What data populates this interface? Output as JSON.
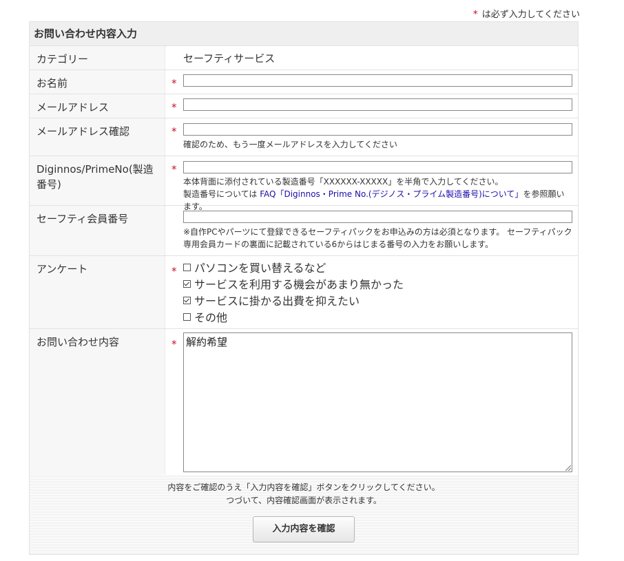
{
  "required_note": {
    "marker": "*",
    "text": "は必ず入力してください"
  },
  "form": {
    "title": "お問い合わせ内容入力",
    "category": {
      "label": "カテゴリー",
      "value": "セーフティサービス"
    },
    "name": {
      "label": "お名前",
      "value": ""
    },
    "email": {
      "label": "メールアドレス",
      "value": ""
    },
    "email_confirm": {
      "label": "メールアドレス確認",
      "value": "",
      "help": "確認のため、もう一度メールアドレスを入力してください"
    },
    "serial": {
      "label": "Diginnos/PrimeNo(製造番号)",
      "value": "",
      "help1": "本体背面に添付されている製造番号「XXXXXX-XXXXX」を半角で入力してください。",
      "help2_prefix": "製造番号については",
      "help2_link": "FAQ「Diginnos・Prime No.(デジノス・プライム製造番号)について」",
      "help2_suffix": "を参照願います。"
    },
    "member": {
      "label": "セーフティ会員番号",
      "value": "",
      "help": "※自作PCやパーツにて登録できるセーフティパックをお申込みの方は必須となります。 セーフティパック専用会員カードの裏面に記載されている6からはじまる番号の入力をお願いします。"
    },
    "survey": {
      "label": "アンケート",
      "options": [
        {
          "label": "パソコンを買い替えるなど",
          "checked": false
        },
        {
          "label": "サービスを利用する機会があまり無かった",
          "checked": true
        },
        {
          "label": "サービスに掛かる出費を抑えたい",
          "checked": true
        },
        {
          "label": "その他",
          "checked": false
        }
      ]
    },
    "inquiry": {
      "label": "お問い合わせ内容",
      "value": "解約希望"
    }
  },
  "footer": {
    "message_line1": "内容をご確認のうえ「入力内容を確認」ボタンをクリックしてください。",
    "message_line2": "つづいて、内容確認画面が表示されます。",
    "confirm_button": "入力内容を確認"
  },
  "colors": {
    "required": "#c8102e",
    "link": "#1a0dab",
    "header_bg": "#efefef",
    "label_bg": "#f7f7f7"
  }
}
